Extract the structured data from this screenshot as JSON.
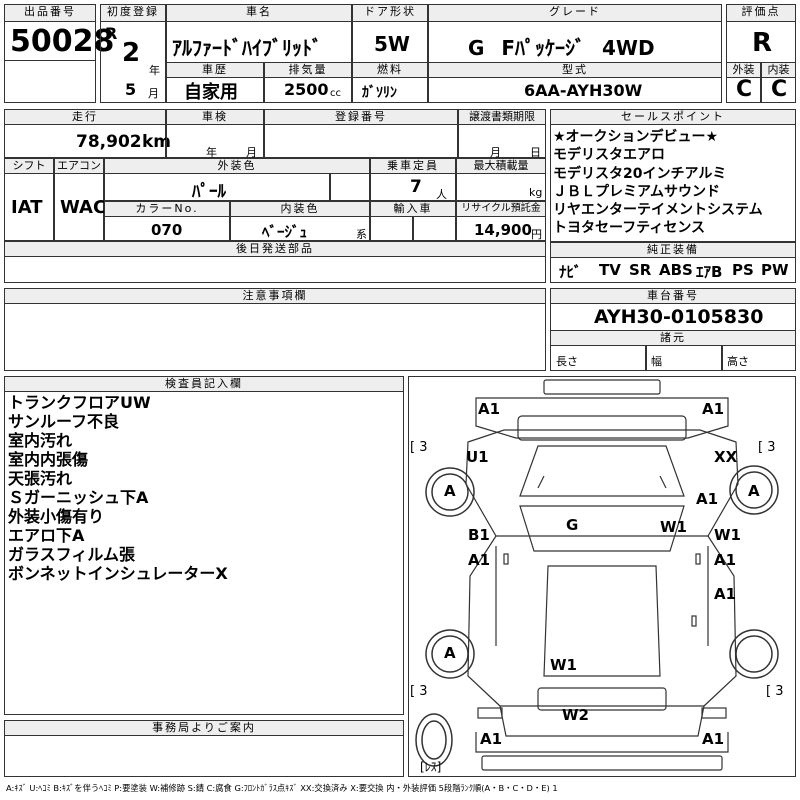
{
  "header": {
    "lot_label": "出品番号",
    "lot_value": "50028",
    "first_reg_label": "初度登録",
    "era": "R",
    "year": "2",
    "year_unit": "年",
    "month": "5",
    "month_unit": "月",
    "name_label": "車名",
    "name_value": "ｱﾙﾌｧｰﾄﾞﾊｲﾌﾞﾘｯﾄﾞ",
    "door_label": "ドア形状",
    "door_value": "5W",
    "grade_label": "グレード",
    "grade_value": "G Fﾊﾟｯｹｰｼﾞ 4WD",
    "score_label": "評価点",
    "score_value": "R",
    "history_label": "車歴",
    "history_value": "自家用",
    "displacement_label": "排気量",
    "displacement_value": "2500",
    "displacement_unit": "cc",
    "fuel_label": "燃料",
    "fuel_value": "ｶﾞｿﾘﾝ",
    "model_label": "型式",
    "model_value": "6AA-AYH30W",
    "exterior_label": "外装",
    "exterior_value": "C",
    "interior_label": "内装",
    "interior_value": "C"
  },
  "mid": {
    "mileage_label": "走行",
    "mileage_value": "78,902",
    "mileage_unit": "km",
    "inspection_label": "車検",
    "inspection_year_unit": "年",
    "inspection_month_unit": "月",
    "reg_no_label": "登録番号",
    "transfer_label": "譲渡書類期限",
    "transfer_month_unit": "月",
    "transfer_day_unit": "日",
    "shift_label": "シフト",
    "shift_value": "IAT",
    "ac_label": "エアコン",
    "ac_value": "WAC",
    "color_label": "外装色",
    "color_value": "ﾊﾟｰﾙ",
    "capacity_label": "乗車定員",
    "capacity_value": "7",
    "capacity_unit": "人",
    "load_label": "最大積載量",
    "load_unit": "kg",
    "color_no_label": "カラーNo.",
    "color_no_value": "070",
    "int_color_label": "内装色",
    "int_color_value": "ﾍﾞｰｼﾞｭ",
    "int_color_unit": "系",
    "import_label": "輸入車",
    "recycle_label": "リサイクル預託金",
    "recycle_value": "14,900",
    "recycle_unit": "円",
    "later_parts_label": "後日発送部品"
  },
  "sales": {
    "label": "セールスポイント",
    "items": [
      "★オークションデビュー★",
      "モデリスタエアロ",
      "モデリスタ20インチアルミ",
      "ＪＢＬプレミアムサウンド",
      "リヤエンターテイメントシステム",
      "トヨタセーフティセンス"
    ]
  },
  "equipment": {
    "label": "純正装備",
    "items": [
      "ﾅﾋﾞ",
      "TV",
      "SR",
      "ABS",
      "ｴｱB",
      "PS",
      "PW"
    ]
  },
  "notes": {
    "label": "注意事項欄"
  },
  "chassis": {
    "label": "車台番号",
    "value": "AYH30-0105830",
    "dims_label": "諸元",
    "length_label": "長さ",
    "width_label": "幅",
    "height_label": "高さ"
  },
  "inspector": {
    "label": "検査員記入欄",
    "lines": [
      "トランクフロアUW",
      "サンルーフ不良",
      "室内汚れ",
      "室内内張傷",
      "天張汚れ",
      "Ｓガーニッシュ下A",
      "外装小傷有り",
      "エアロ下A",
      "ガラスフィルム張",
      "ボンネットインシュレーターX"
    ]
  },
  "office": {
    "label": "事務局よりご案内"
  },
  "diagram": {
    "marks": {
      "a1_tl": "A1",
      "a1_tr": "A1",
      "u1": "U1",
      "xx": "XX",
      "bracket_tl": "[ 3",
      "bracket_tr": "[ 3",
      "bracket_bl": "[ 3",
      "bracket_br": "[ 3",
      "tire_fl": "A",
      "tire_fr": "A",
      "tire_rl": "A",
      "a1_fr": "A1",
      "w1_fr": "W1",
      "g": "G",
      "b1": "B1",
      "a1_ld": "A1",
      "w1_r": "W1",
      "a1_rd": "A1",
      "a1_rq": "A1",
      "w1_rear": "W1",
      "w2": "W2",
      "a1_bl": "A1",
      "a1_br": "A1",
      "spare_label": "[ﾚｽ]"
    }
  },
  "legend": "A:ｷｽﾞ U:ﾍｺﾐ B:ｷｽﾞを伴うﾍｺﾐ P:要塗装 W:補修跡 S:錆 C:腐食 G:ﾌﾛﾝﾄｶﾞﾗｽ点ｷｽﾞ XX:交換済み X:要交換 内・外装評価 5段階ﾗﾝｸ順(A・B・C・D・E) 1"
}
